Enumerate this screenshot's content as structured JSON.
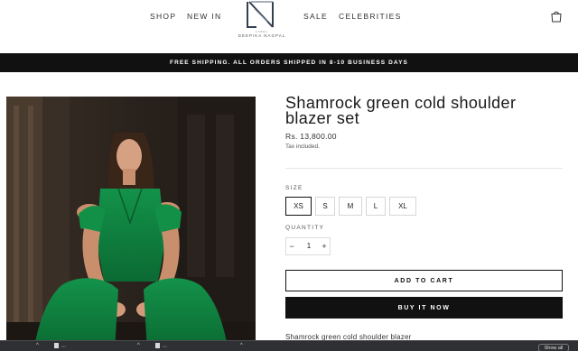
{
  "header": {
    "nav_left": [
      "SHOP",
      "NEW IN"
    ],
    "nav_right": [
      "SALE",
      "CELEBRITIES"
    ],
    "logo_text": "DEEPIKA NAGPAL",
    "logo_sub": "LABEL"
  },
  "announcement": "FREE SHIPPING. ALL ORDERS SHIPPED IN 8-10 BUSINESS DAYS",
  "product": {
    "title": "Shamrock green cold shoulder blazer set",
    "price": "Rs. 13,800.00",
    "tax_note": "Tax included.",
    "size_label": "SIZE",
    "sizes": [
      "XS",
      "S",
      "M",
      "L",
      "XL"
    ],
    "selected_size": "XS",
    "quantity_label": "QUANTITY",
    "quantity": "1",
    "add_to_cart": "ADD TO CART",
    "buy_now": "BUY IT NOW",
    "description_start": "Shamrock green cold shoulder blazer"
  },
  "downloads_bar": {
    "items": [
      "...",
      "...",
      "..."
    ],
    "show_all": "Show all"
  },
  "colors": {
    "accent_dark": "#111111",
    "dress_green": "#0f7a3a"
  }
}
